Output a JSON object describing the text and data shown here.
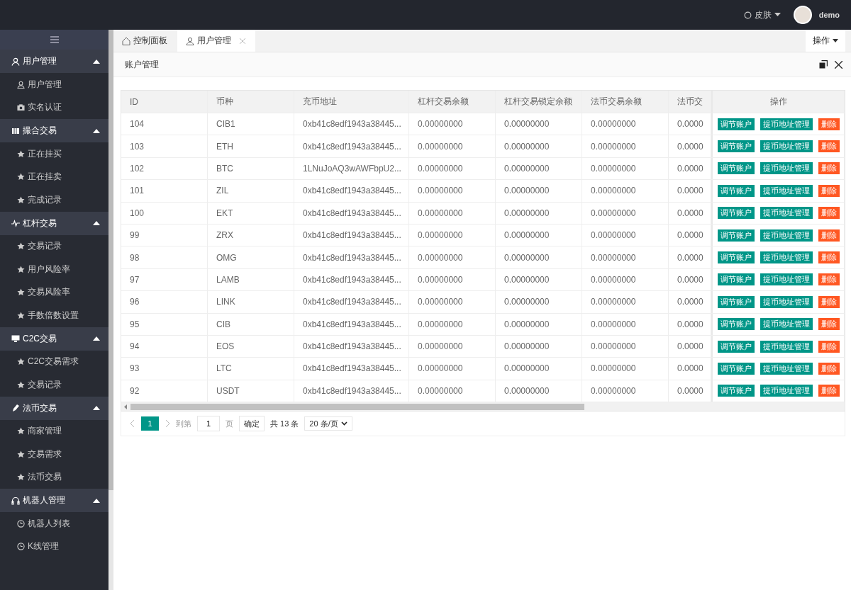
{
  "topbar": {
    "skin": "皮肤",
    "user": "demo"
  },
  "sidebar": {
    "groups": [
      {
        "label": "用户管理",
        "expanded": true,
        "items": [
          {
            "label": "用户管理"
          },
          {
            "label": "实名认证"
          }
        ]
      },
      {
        "label": "撮合交易",
        "expanded": true,
        "items": [
          {
            "label": "正在挂买"
          },
          {
            "label": "正在挂卖"
          },
          {
            "label": "完成记录"
          }
        ]
      },
      {
        "label": "杠杆交易",
        "expanded": true,
        "items": [
          {
            "label": "交易记录"
          },
          {
            "label": "用户风险率"
          },
          {
            "label": "交易风险率"
          },
          {
            "label": "手数倍数设置"
          }
        ]
      },
      {
        "label": "C2C交易",
        "expanded": true,
        "items": [
          {
            "label": "C2C交易需求"
          },
          {
            "label": "交易记录"
          }
        ]
      },
      {
        "label": "法币交易",
        "expanded": true,
        "items": [
          {
            "label": "商家管理"
          },
          {
            "label": "交易需求"
          },
          {
            "label": "法币交易"
          }
        ]
      },
      {
        "label": "机器人管理",
        "expanded": true,
        "items": [
          {
            "label": "机器人列表"
          },
          {
            "label": "K线管理"
          }
        ]
      }
    ]
  },
  "tabs": [
    {
      "label": "控制面板",
      "closable": false,
      "selected": false
    },
    {
      "label": "用户管理",
      "closable": true,
      "selected": true
    }
  ],
  "tab_menu": "操作",
  "card": {
    "title": "账户管理"
  },
  "table": {
    "columns": [
      "ID",
      "币种",
      "充币地址",
      "杠杆交易余额",
      "杠杆交易锁定余额",
      "法币交易余额",
      "法币交"
    ],
    "action_column": "操作",
    "rows": [
      {
        "cells": [
          "104",
          "CIB1",
          "0xb41c8edf1943a38445...",
          "0.00000000",
          "0.00000000",
          "0.00000000",
          "0.0000"
        ],
        "actions": [
          {
            "label": "调节账户",
            "kind": "primary"
          },
          {
            "label": "提币地址管理",
            "kind": "primary"
          },
          {
            "label": "删除",
            "kind": "danger"
          }
        ]
      },
      {
        "cells": [
          "103",
          "ETH",
          "0xb41c8edf1943a38445...",
          "0.00000000",
          "0.00000000",
          "0.00000000",
          "0.0000"
        ],
        "actions": [
          {
            "label": "调节账户",
            "kind": "primary"
          },
          {
            "label": "提币地址管理",
            "kind": "primary"
          },
          {
            "label": "删除",
            "kind": "danger"
          }
        ]
      },
      {
        "cells": [
          "102",
          "BTC",
          "1LNuJoAQ3wAWFbpU2...",
          "0.00000000",
          "0.00000000",
          "0.00000000",
          "0.0000"
        ],
        "actions": [
          {
            "label": "调节账户",
            "kind": "primary"
          },
          {
            "label": "提币地址管理",
            "kind": "primary"
          },
          {
            "label": "删除",
            "kind": "danger"
          }
        ]
      },
      {
        "cells": [
          "101",
          "ZIL",
          "0xb41c8edf1943a38445...",
          "0.00000000",
          "0.00000000",
          "0.00000000",
          "0.0000"
        ],
        "actions": [
          {
            "label": "调节账户",
            "kind": "primary"
          },
          {
            "label": "提币地址管理",
            "kind": "primary"
          },
          {
            "label": "删除",
            "kind": "danger"
          }
        ]
      },
      {
        "cells": [
          "100",
          "EKT",
          "0xb41c8edf1943a38445...",
          "0.00000000",
          "0.00000000",
          "0.00000000",
          "0.0000"
        ],
        "actions": [
          {
            "label": "调节账户",
            "kind": "primary"
          },
          {
            "label": "提币地址管理",
            "kind": "primary"
          },
          {
            "label": "删除",
            "kind": "danger"
          }
        ]
      },
      {
        "cells": [
          "99",
          "ZRX",
          "0xb41c8edf1943a38445...",
          "0.00000000",
          "0.00000000",
          "0.00000000",
          "0.0000"
        ],
        "actions": [
          {
            "label": "调节账户",
            "kind": "primary"
          },
          {
            "label": "提币地址管理",
            "kind": "primary"
          },
          {
            "label": "删除",
            "kind": "danger"
          }
        ]
      },
      {
        "cells": [
          "98",
          "OMG",
          "0xb41c8edf1943a38445...",
          "0.00000000",
          "0.00000000",
          "0.00000000",
          "0.0000"
        ],
        "actions": [
          {
            "label": "调节账户",
            "kind": "primary"
          },
          {
            "label": "提币地址管理",
            "kind": "primary"
          },
          {
            "label": "删除",
            "kind": "danger"
          }
        ]
      },
      {
        "cells": [
          "97",
          "LAMB",
          "0xb41c8edf1943a38445...",
          "0.00000000",
          "0.00000000",
          "0.00000000",
          "0.0000"
        ],
        "actions": [
          {
            "label": "调节账户",
            "kind": "primary"
          },
          {
            "label": "提币地址管理",
            "kind": "primary"
          },
          {
            "label": "删除",
            "kind": "danger"
          }
        ]
      },
      {
        "cells": [
          "96",
          "LINK",
          "0xb41c8edf1943a38445...",
          "0.00000000",
          "0.00000000",
          "0.00000000",
          "0.0000"
        ],
        "actions": [
          {
            "label": "调节账户",
            "kind": "primary"
          },
          {
            "label": "提币地址管理",
            "kind": "primary"
          },
          {
            "label": "删除",
            "kind": "danger"
          }
        ]
      },
      {
        "cells": [
          "95",
          "CIB",
          "0xb41c8edf1943a38445...",
          "0.00000000",
          "0.00000000",
          "0.00000000",
          "0.0000"
        ],
        "actions": [
          {
            "label": "调节账户",
            "kind": "primary"
          },
          {
            "label": "提币地址管理",
            "kind": "primary"
          },
          {
            "label": "删除",
            "kind": "danger"
          }
        ]
      },
      {
        "cells": [
          "94",
          "EOS",
          "0xb41c8edf1943a38445...",
          "0.00000000",
          "0.00000000",
          "0.00000000",
          "0.0000"
        ],
        "actions": [
          {
            "label": "调节账户",
            "kind": "primary"
          },
          {
            "label": "提币地址管理",
            "kind": "primary"
          },
          {
            "label": "删除",
            "kind": "danger"
          }
        ]
      },
      {
        "cells": [
          "93",
          "LTC",
          "0xb41c8edf1943a38445...",
          "0.00000000",
          "0.00000000",
          "0.00000000",
          "0.0000"
        ],
        "actions": [
          {
            "label": "调节账户",
            "kind": "primary"
          },
          {
            "label": "提币地址管理",
            "kind": "primary"
          },
          {
            "label": "删除",
            "kind": "danger"
          }
        ]
      },
      {
        "cells": [
          "92",
          "USDT",
          "0xb41c8edf1943a38445...",
          "0.00000000",
          "0.00000000",
          "0.00000000",
          "0.0000"
        ],
        "actions": [
          {
            "label": "调节账户",
            "kind": "primary"
          },
          {
            "label": "提币地址管理",
            "kind": "primary"
          },
          {
            "label": "删除",
            "kind": "danger"
          }
        ]
      }
    ]
  },
  "pagination": {
    "pages": [
      {
        "label": "1",
        "selected": true
      }
    ],
    "goto_label": "到第",
    "page_input": "1",
    "page_label": "页",
    "confirm": "确定",
    "total": "共 13 条",
    "page_size": "20 条/页"
  }
}
